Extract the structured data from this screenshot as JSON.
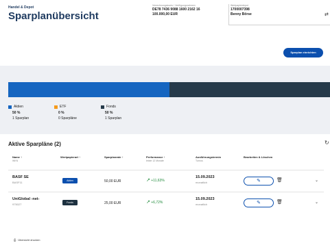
{
  "header": {
    "breadcrumb": "Handel & Depot",
    "title": "Sparplanübersicht",
    "account": {
      "label": "Verrechnungskonto / Verfügungsrahmen",
      "iban_prefix": "DE78 7436 9088 ",
      "iban_bold": "1600 2162 16",
      "amount": "100.000,00 EUR"
    },
    "depot": {
      "label": "Wertpapierdepot",
      "number": "1700007398",
      "owner": "Benny Börse"
    }
  },
  "toolbar": {
    "create_label": "Sparplan einrichten"
  },
  "summary": {
    "colors": {
      "aktien": "#1565c0",
      "etf": "#f59a1a",
      "fonds": "#263a4a"
    },
    "bar_shares": {
      "aktien": 50,
      "etf": 0,
      "fonds": 50
    },
    "items": [
      {
        "label": "Aktien",
        "pct": "50 %",
        "count": "1 Sparplan"
      },
      {
        "label": "ETF",
        "pct": "0 %",
        "count": "0 Sparpläne"
      },
      {
        "label": "Fonds",
        "pct": "50 %",
        "count": "1 Sparplan"
      }
    ]
  },
  "table": {
    "title": "Aktive Sparpläne (2)",
    "columns": [
      {
        "title": "Name ↑",
        "sub": "WKN"
      },
      {
        "title": "Wertpapierart ↑",
        "sub": ""
      },
      {
        "title": "Sparplanrate ↑",
        "sub": ""
      },
      {
        "title": "Performance ↑",
        "sub": "letzte 12 Monate"
      },
      {
        "title": "Ausführungstermin",
        "sub": "Turnus"
      },
      {
        "title": "Bearbeiten & Löschen",
        "sub": ""
      }
    ],
    "rows": [
      {
        "name": "BASF SE",
        "wkn": "BASF11",
        "type": "Aktien",
        "type_color": "#0b4fae",
        "rate": "50,00 EUR",
        "perf": "+11,63%",
        "date": "15.09.2023",
        "freq": "monatlich"
      },
      {
        "name": "UniGlobal -net-",
        "wkn": "975027",
        "type": "Fonds",
        "type_color": "#1d3140",
        "rate": "25,00 EUR",
        "perf": "+6,72%",
        "date": "15.09.2023",
        "freq": "monatlich"
      }
    ]
  },
  "footer": {
    "print_label": "Übersicht drucken"
  }
}
